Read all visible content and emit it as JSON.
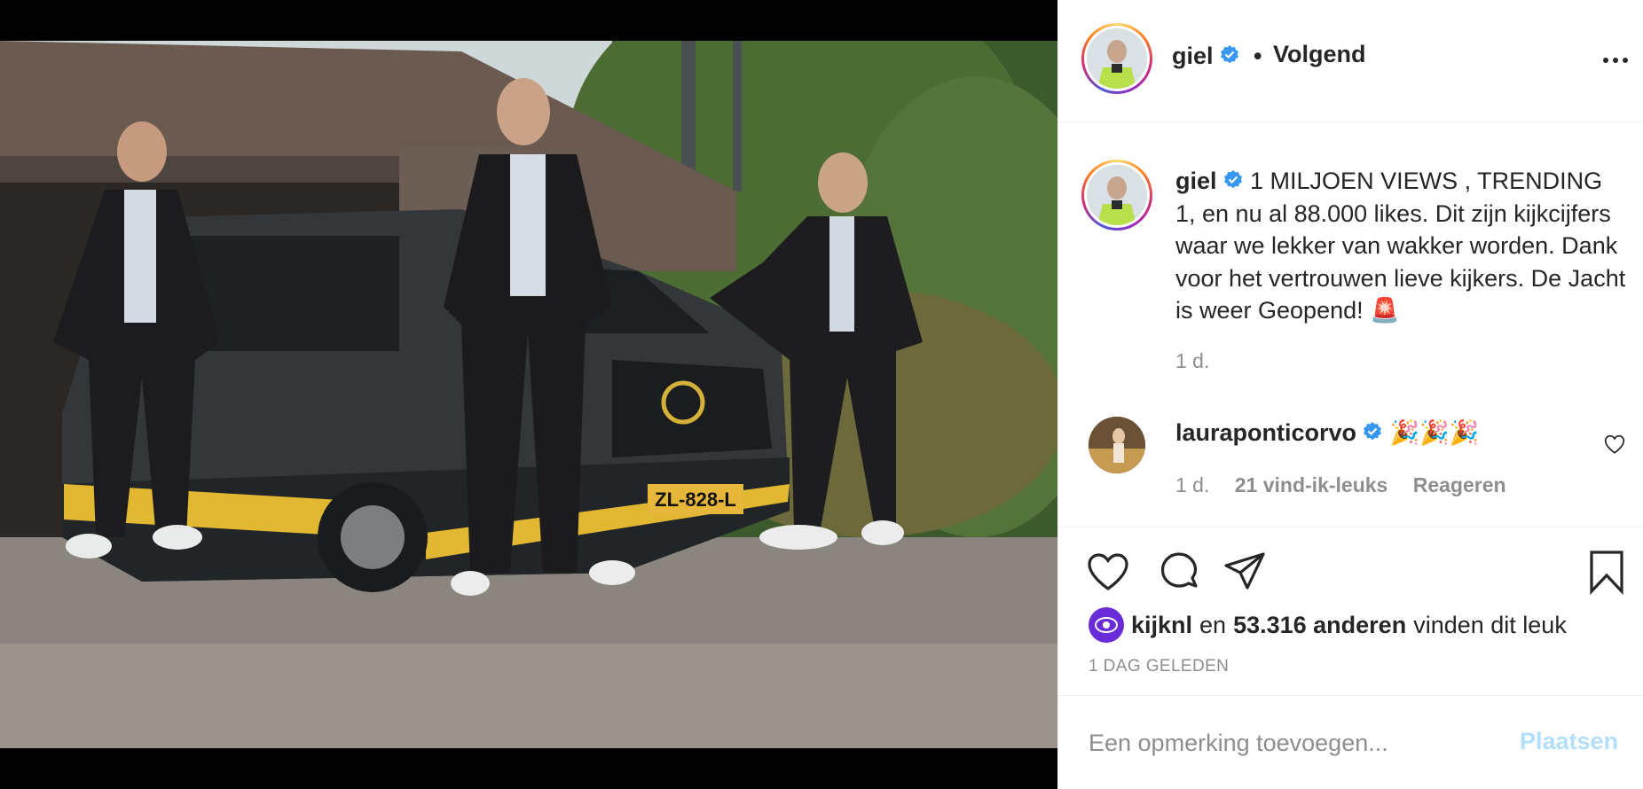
{
  "post": {
    "photo_alt": "Three men in black jackets standing in front of a dark grey van with yellow stripe",
    "license_plate": "ZL-828-L"
  },
  "header": {
    "username": "giel",
    "separator": "•",
    "follow_status": "Volgend"
  },
  "caption": {
    "username": "giel",
    "text": "1 MILJOEN VIEWS , TRENDING 1, en nu al 88.000 likes. Dit zijn kijkcijfers waar we lekker van wakker worden. Dank voor het vertrouwen lieve kijkers. De Jacht is weer Geopend! 🚨",
    "time": "1 d."
  },
  "comment": {
    "username": "lauraponticorvo",
    "text": "🎉🎉🎉",
    "time": "1 d.",
    "likes": "21 vind-ik-leuks",
    "reply": "Reageren"
  },
  "likes": {
    "first_user": "kijknl",
    "connector": "en",
    "others": "53.316 anderen",
    "suffix": "vinden dit leuk"
  },
  "posted": "1 DAG GELEDEN",
  "add_comment": {
    "placeholder": "Een opmerking toevoegen...",
    "post_label": "Plaatsen"
  },
  "colors": {
    "verified": "#3897f0",
    "muted": "#8e8e8e",
    "post_disabled": "#b2dffc",
    "text": "#262626"
  }
}
